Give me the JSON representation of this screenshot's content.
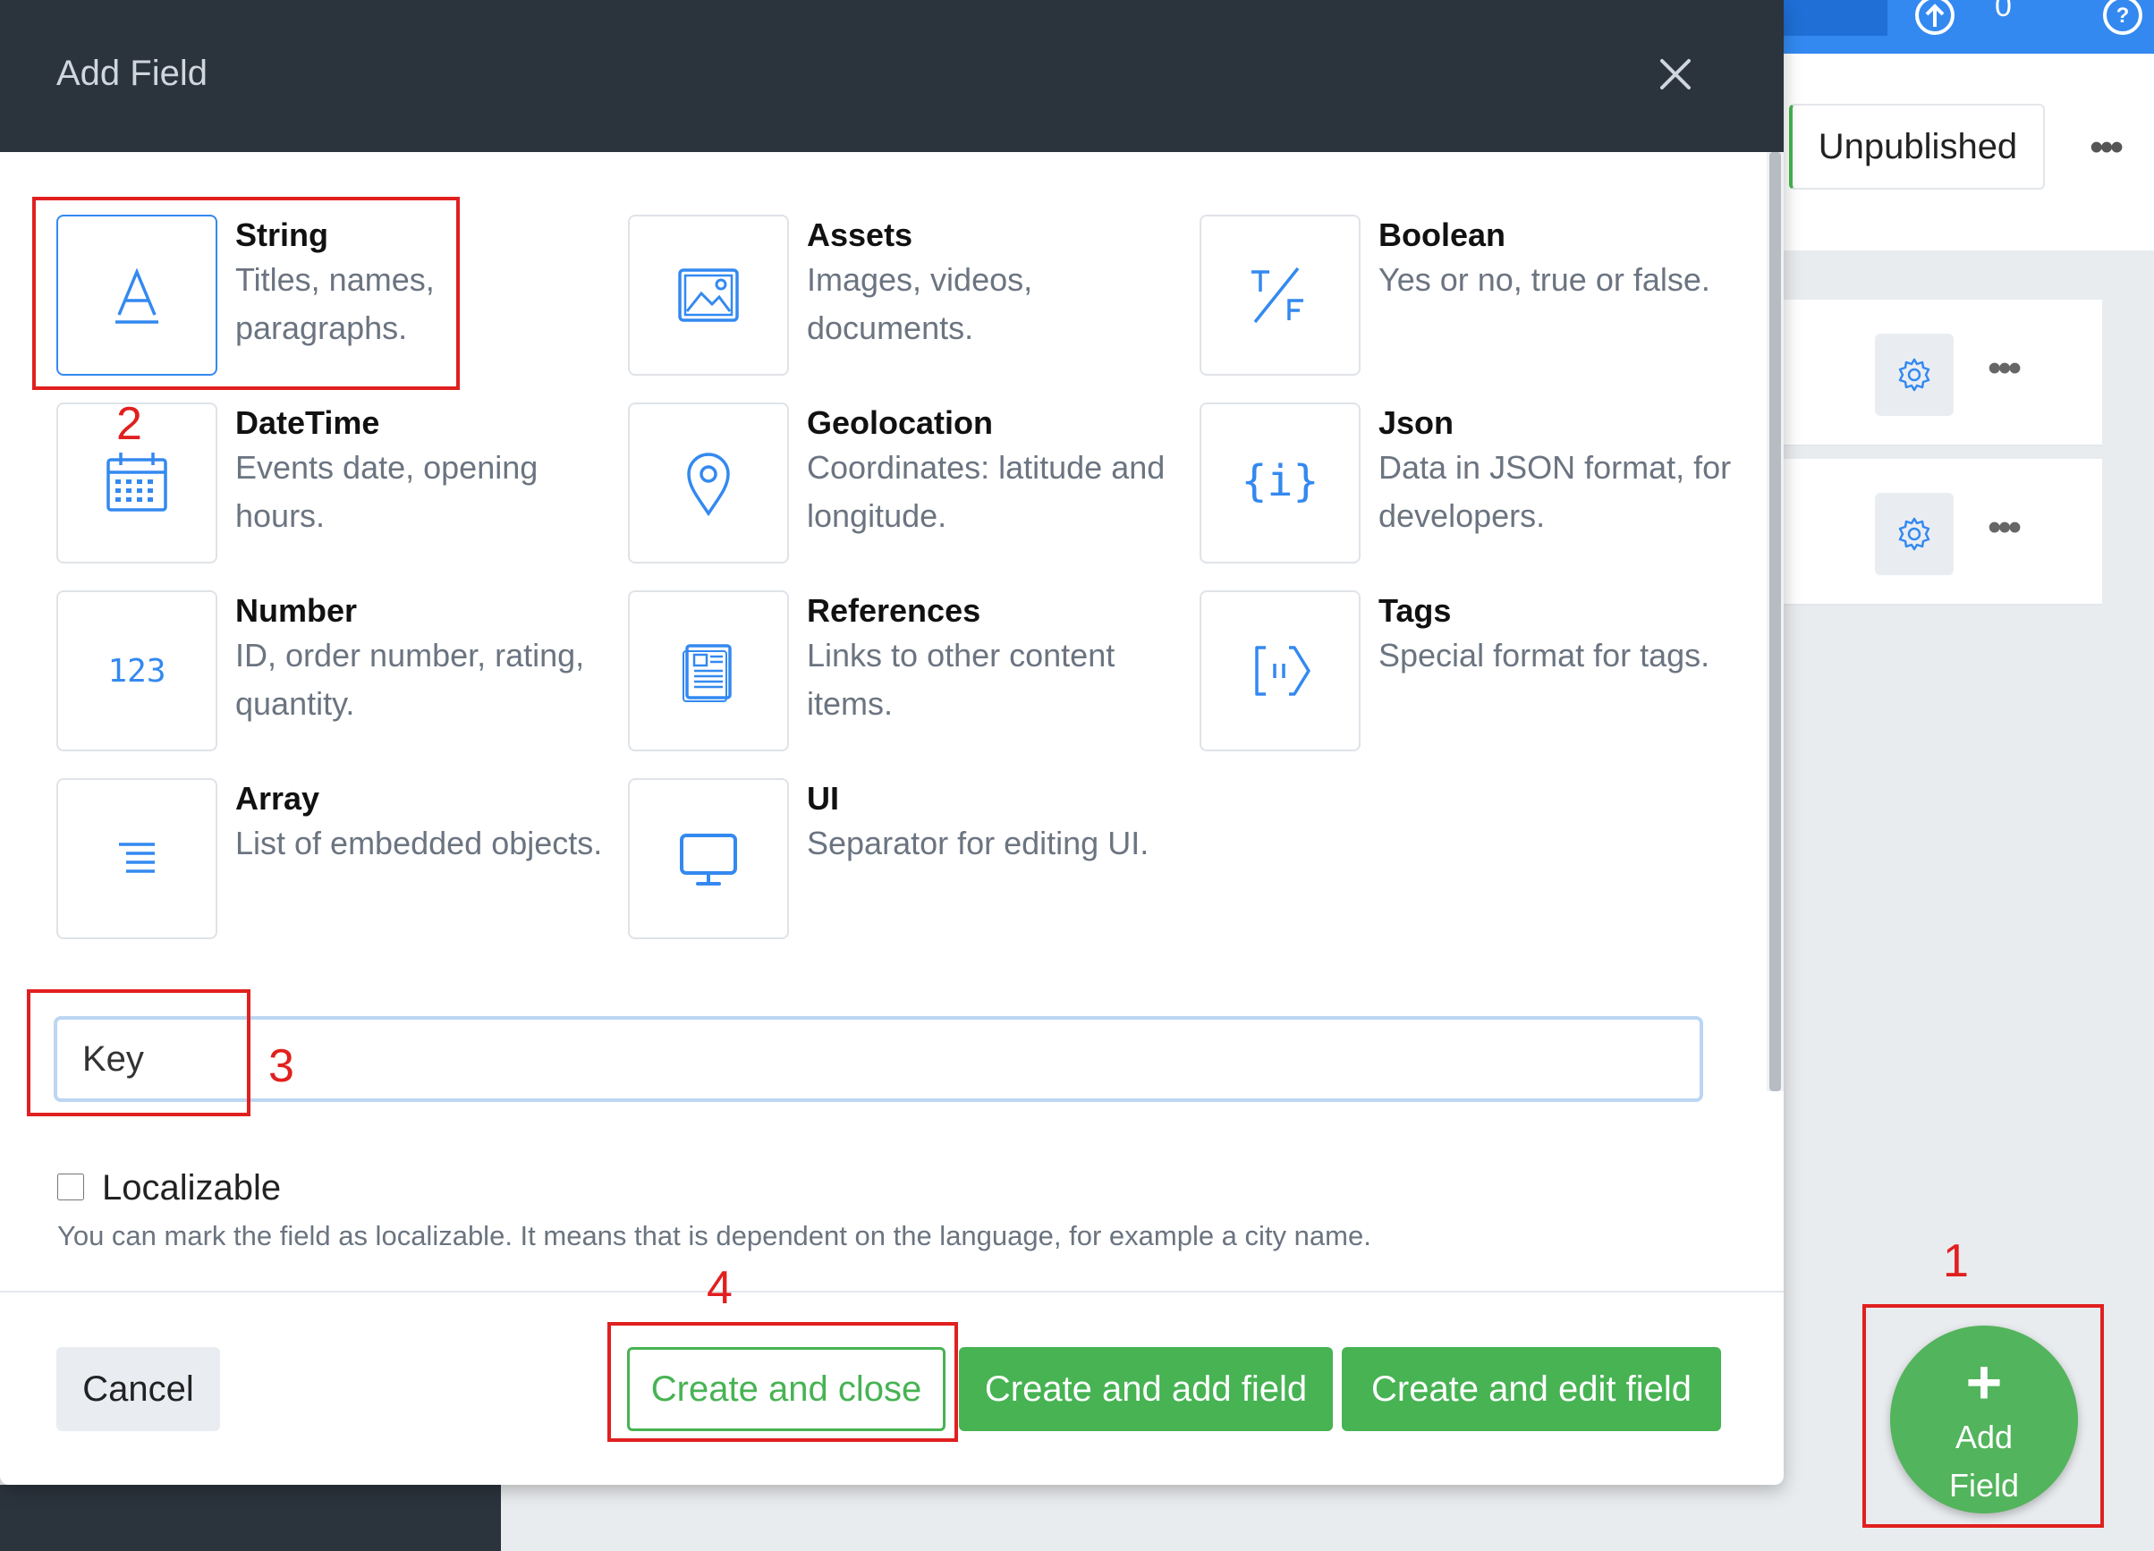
{
  "background": {
    "top_bar_badge": "0",
    "status_button": "Unpublished",
    "more_dots": "•••",
    "fab": {
      "plus": "+",
      "label_line1": "Add",
      "label_line2": "Field"
    }
  },
  "modal": {
    "title": "Add Field",
    "field_types": [
      {
        "name": "String",
        "description": "Titles, names, paragraphs.",
        "icon": "string-icon"
      },
      {
        "name": "Assets",
        "description": "Images, videos, documents.",
        "icon": "image-icon"
      },
      {
        "name": "Boolean",
        "description": "Yes or no, true or false.",
        "icon": "true-false-icon"
      },
      {
        "name": "DateTime",
        "description": "Events date, opening hours.",
        "icon": "calendar-icon"
      },
      {
        "name": "Geolocation",
        "description": "Coordinates: latitude and longitude.",
        "icon": "map-pin-icon"
      },
      {
        "name": "Json",
        "description": "Data in JSON format, for developers.",
        "icon": "json-icon"
      },
      {
        "name": "Number",
        "description": "ID, order number, rating, quantity.",
        "icon": "number-icon"
      },
      {
        "name": "References",
        "description": "Links to other content items.",
        "icon": "document-icon"
      },
      {
        "name": "Tags",
        "description": "Special format for tags.",
        "icon": "tag-icon"
      },
      {
        "name": "Array",
        "description": "List of embedded objects.",
        "icon": "list-icon"
      },
      {
        "name": "UI",
        "description": "Separator for editing UI.",
        "icon": "monitor-icon"
      }
    ],
    "selected_type": "String",
    "name_input": {
      "value": "Key"
    },
    "localizable": {
      "label": "Localizable",
      "checked": false,
      "hint": "You can mark the field as localizable. It means that is dependent on the language, for example a city name."
    },
    "buttons": {
      "cancel": "Cancel",
      "create_close": "Create and close",
      "create_add": "Create and add field",
      "create_edit": "Create and edit field"
    }
  },
  "annotations": {
    "n1": "1",
    "n2": "2",
    "n3": "3",
    "n4": "4"
  },
  "colors": {
    "accent_blue": "#3389f0",
    "green": "#47b353",
    "header_dark": "#2b333d",
    "annotation_red": "#e0201f"
  }
}
